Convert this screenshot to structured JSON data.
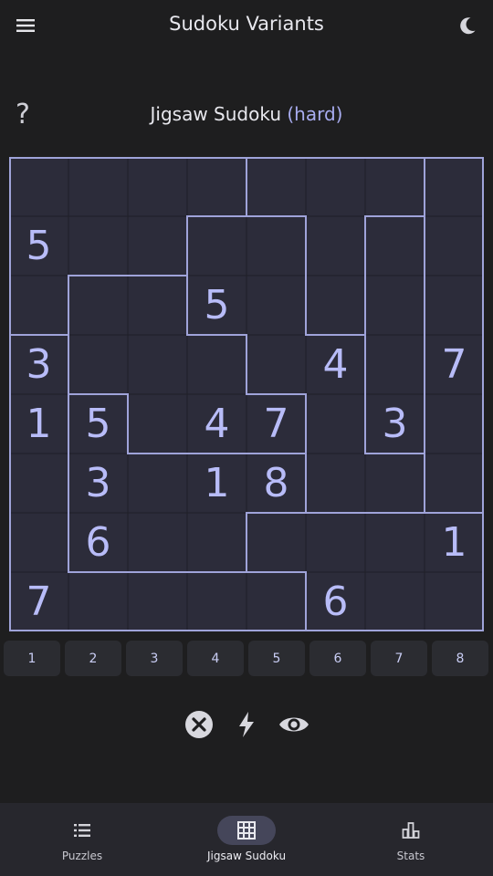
{
  "app": {
    "title": "Sudoku Variants",
    "menu_icon": "hamburger-menu-icon",
    "theme_icon": "dark-mode-moon-icon"
  },
  "puzzle": {
    "help_label": "?",
    "name": "Jigsaw Sudoku",
    "difficulty": "(hard)",
    "size": 8,
    "regions": [
      [
        0,
        0,
        0,
        0,
        1,
        1,
        1,
        2
      ],
      [
        0,
        0,
        0,
        3,
        3,
        1,
        4,
        2
      ],
      [
        0,
        5,
        5,
        3,
        3,
        1,
        4,
        2
      ],
      [
        6,
        5,
        5,
        5,
        3,
        3,
        4,
        2
      ],
      [
        6,
        7,
        5,
        5,
        5,
        3,
        4,
        2
      ],
      [
        6,
        7,
        7,
        7,
        7,
        3,
        3,
        2
      ],
      [
        6,
        7,
        7,
        7,
        4,
        4,
        4,
        4
      ],
      [
        6,
        6,
        6,
        6,
        6,
        4,
        4,
        4
      ]
    ],
    "givens": [
      [
        null,
        null,
        null,
        null,
        null,
        null,
        null,
        null
      ],
      [
        "5",
        null,
        null,
        null,
        null,
        null,
        null,
        null
      ],
      [
        null,
        null,
        null,
        "5",
        null,
        null,
        null,
        null
      ],
      [
        "3",
        null,
        null,
        null,
        null,
        "4",
        null,
        "7"
      ],
      [
        "1",
        "5",
        null,
        "4",
        "7",
        null,
        "3",
        null
      ],
      [
        null,
        "3",
        null,
        "1",
        "8",
        null,
        null,
        null
      ],
      [
        null,
        "6",
        null,
        null,
        null,
        null,
        null,
        "1"
      ],
      [
        "7",
        null,
        null,
        null,
        null,
        "6",
        null,
        null
      ]
    ],
    "colors": {
      "cell": "#2c2c3a",
      "region_border": "#9fa3d9",
      "digit": "#b8bcf8"
    }
  },
  "numpad": [
    "1",
    "2",
    "3",
    "4",
    "5",
    "6",
    "7",
    "8"
  ],
  "actions": [
    {
      "name": "clear",
      "icon": "clear-x-circle-icon"
    },
    {
      "name": "hint",
      "icon": "lightning-bolt-icon"
    },
    {
      "name": "reveal",
      "icon": "eye-icon"
    }
  ],
  "bottom_nav": [
    {
      "label": "Puzzles",
      "icon": "list-icon",
      "active": false
    },
    {
      "label": "Jigsaw Sudoku",
      "icon": "grid-icon",
      "active": true
    },
    {
      "label": "Stats",
      "icon": "bar-chart-icon",
      "active": false
    }
  ]
}
